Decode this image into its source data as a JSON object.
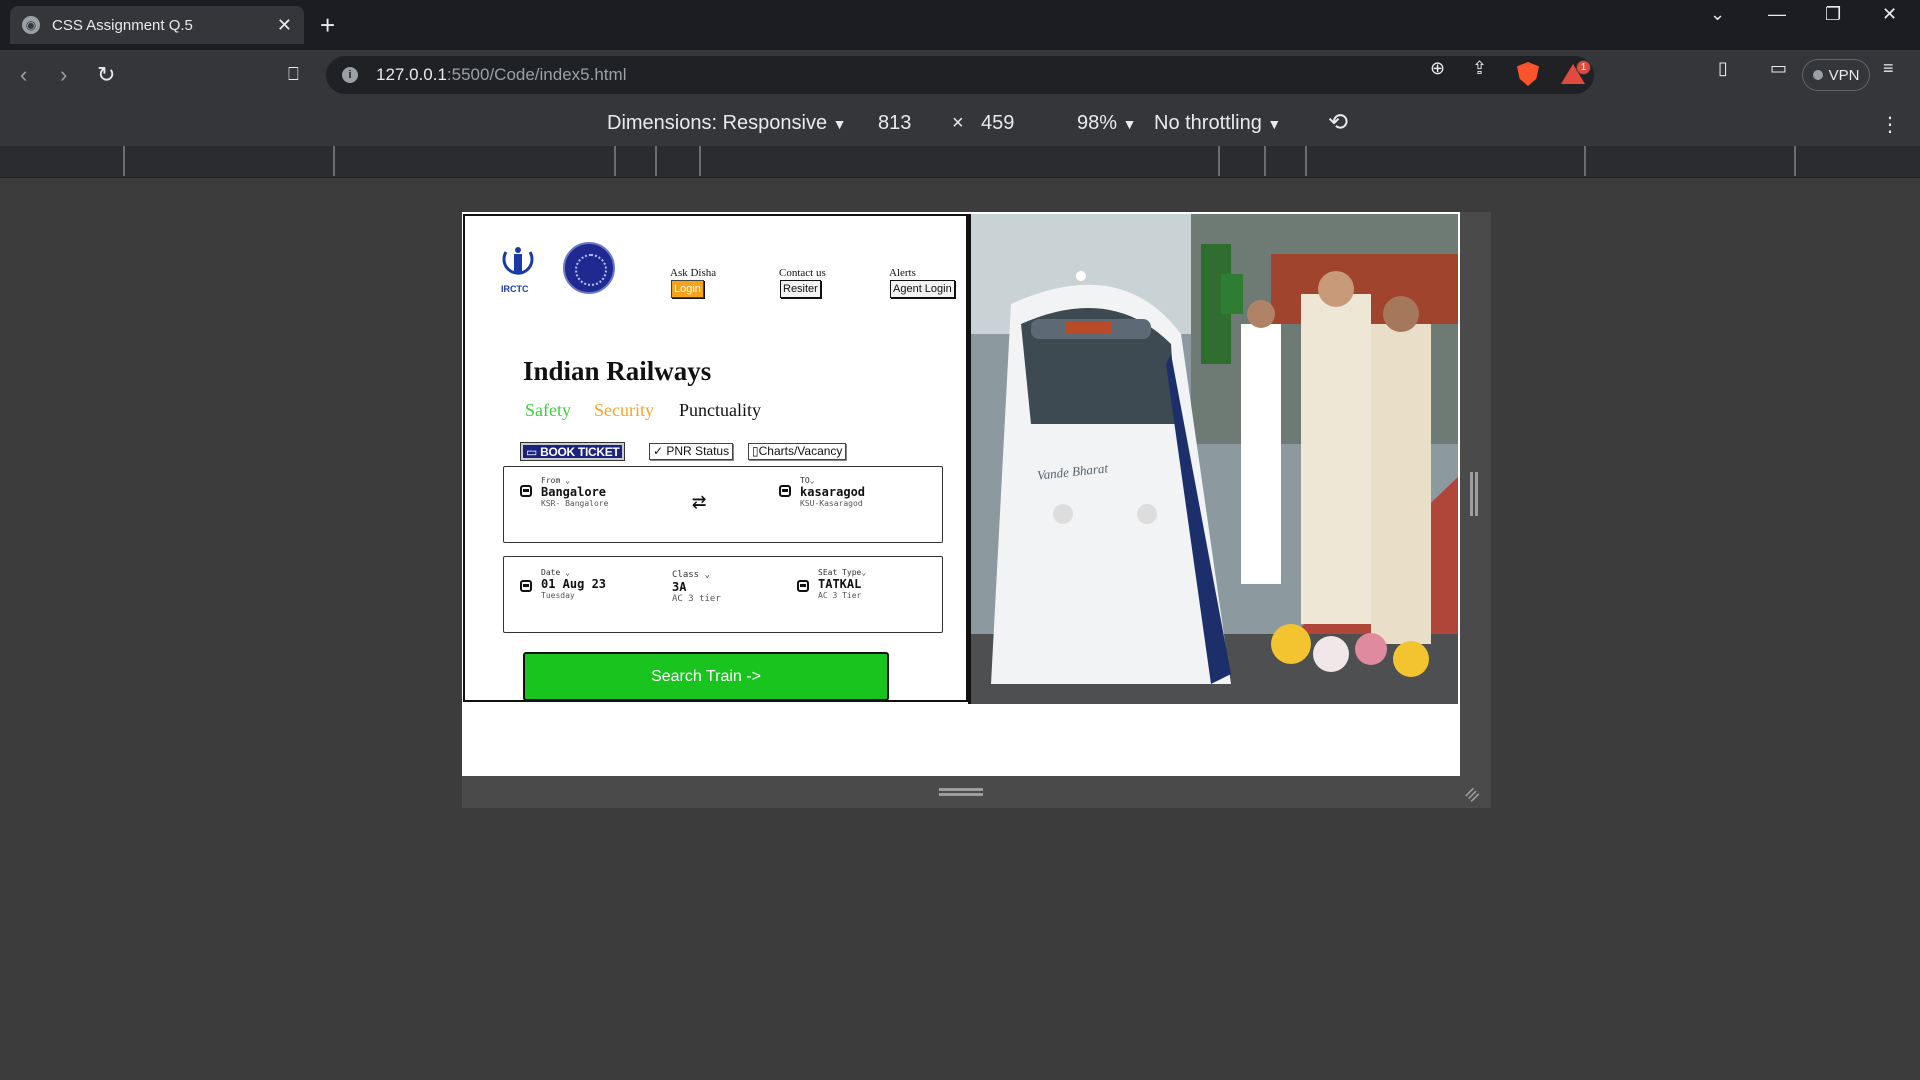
{
  "browser": {
    "tab_title": "CSS Assignment Q.5",
    "url_host": "127.0.0.1",
    "url_path": ":5500/Code/index5.html",
    "vpn_label": "VPN",
    "notification_count": "1"
  },
  "devtools": {
    "dimensions_label": "Dimensions: Responsive",
    "width": "813",
    "times": "×",
    "height": "459",
    "zoom": "98%",
    "throttling": "No throttling"
  },
  "page": {
    "logo_text": "IRCTC",
    "nav": {
      "ask_disha": "Ask Disha",
      "login": "Login",
      "contact": "Contact us",
      "register": "Resiter",
      "alerts": "Alerts",
      "agent_login": "Agent Login"
    },
    "title": "Indian Railways",
    "tagline": {
      "safety": "Safety",
      "security": "Security",
      "punctuality": "Punctuality"
    },
    "tabs": {
      "book": "BOOK TICKET",
      "pnr": "✓ PNR Status",
      "charts": "▯Charts/Vacancy"
    },
    "journey": {
      "from_label": "From",
      "from_value": "Bangalore",
      "from_sub": "KSR- Bangalore",
      "to_label": "TO",
      "to_value": "kasaragod",
      "to_sub": "KSU-Kasaragod",
      "swap": "⇄"
    },
    "details": {
      "date_label": "Date",
      "date_value": "01 Aug 23",
      "date_sub": "Tuesday",
      "class_label": "Class",
      "class_value": "3A",
      "class_sub": "AC 3 tier",
      "seat_label": "SEat Type",
      "seat_value": "TATKAL",
      "seat_sub": "AC 3 Tier"
    },
    "search_button": "Search Train ->",
    "hero_text": "Vande Bharat"
  }
}
